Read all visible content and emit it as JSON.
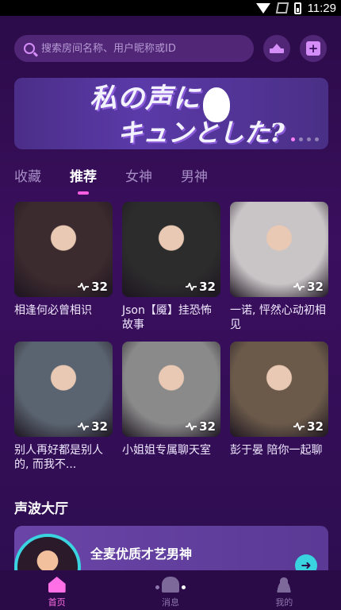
{
  "status_bar": {
    "time": "11:29"
  },
  "search": {
    "placeholder": "搜索房间名称、用户昵称或ID"
  },
  "banner": {
    "line1": "私の声に",
    "line2": "キュンとした?"
  },
  "tabs": [
    {
      "label": "收藏",
      "active": false
    },
    {
      "label": "推荐",
      "active": true
    },
    {
      "label": "女神",
      "active": false
    },
    {
      "label": "男神",
      "active": false
    }
  ],
  "rooms": [
    {
      "title": "相逢何必曾相识",
      "count": "32",
      "bg": "#3b2a2e"
    },
    {
      "title": "Json【魇】挂恐怖故事",
      "count": "32",
      "bg": "#2c2c2c"
    },
    {
      "title": "一诺, 怦然心动初相见",
      "count": "32",
      "bg": "#c9c4c6"
    },
    {
      "title": "别人再好都是别人的, 而我不...",
      "count": "32",
      "bg": "#5a6470"
    },
    {
      "title": "小姐姐专属聊天室",
      "count": "32",
      "bg": "#8a8a8a"
    },
    {
      "title": "彭于晏 陪你一起聊",
      "count": "32",
      "bg": "#6b5a4a"
    }
  ],
  "hall": {
    "title": "声波大厅",
    "card_text": "全麦优质才艺男神"
  },
  "nav": [
    {
      "label": "首页",
      "icon": "home-icon",
      "active": true
    },
    {
      "label": "消息",
      "icon": "bell-icon",
      "active": false
    },
    {
      "label": "我的",
      "icon": "user-icon",
      "active": false
    }
  ],
  "colors": {
    "accent": "#ff6fe6",
    "background": "#2a0b47",
    "cyan": "#3ad3e0"
  }
}
